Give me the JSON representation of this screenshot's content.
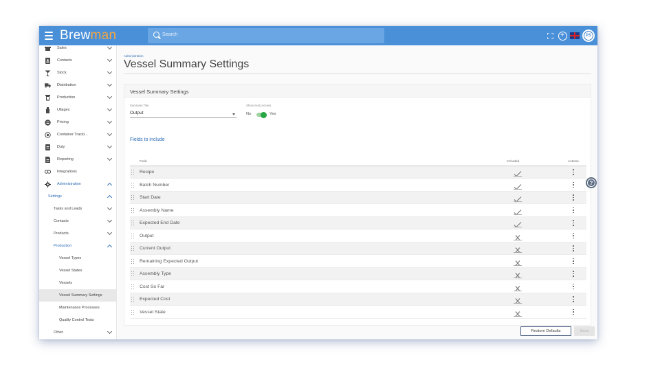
{
  "app": {
    "logo_part1": "Brew",
    "logo_part2": "man",
    "user_initials": "PS"
  },
  "search": {
    "placeholder": "Search"
  },
  "sidebar": {
    "items": [
      {
        "label": "Sales"
      },
      {
        "label": "Contacts"
      },
      {
        "label": "Stock"
      },
      {
        "label": "Distribution"
      },
      {
        "label": "Production"
      },
      {
        "label": "Ullages"
      },
      {
        "label": "Pricing"
      },
      {
        "label": "Container Tracki..."
      },
      {
        "label": "Duty"
      },
      {
        "label": "Reporting"
      },
      {
        "label": "Integrations"
      },
      {
        "label": "Administration"
      },
      {
        "label": "Settings"
      },
      {
        "label": "Tasks and Leads"
      },
      {
        "label": "Contacts"
      },
      {
        "label": "Products"
      },
      {
        "label": "Production"
      },
      {
        "label": "Vessel Types"
      },
      {
        "label": "Vessel States"
      },
      {
        "label": "Vessels"
      },
      {
        "label": "Vessel Summary Settings"
      },
      {
        "label": "Maintenance Processes"
      },
      {
        "label": "Quality Control Tests"
      },
      {
        "label": "Other"
      }
    ]
  },
  "breadcrumb": "Administration",
  "page_title": "Vessel Summary Settings",
  "card": {
    "title": "Vessel Summary Settings",
    "summary_title_label": "Summary Title",
    "summary_title_value": "Output",
    "show_next_label": "Show next process",
    "toggle_no": "No",
    "toggle_yes": "Yes",
    "section_title": "Fields to include"
  },
  "table": {
    "headers": {
      "field": "Field",
      "included": "Included",
      "actions": "Actions"
    },
    "rows": [
      {
        "name": "Recipe",
        "included": true
      },
      {
        "name": "Batch Number",
        "included": true
      },
      {
        "name": "Start Date",
        "included": true
      },
      {
        "name": "Assembly Name",
        "included": true
      },
      {
        "name": "Expected End Date",
        "included": true
      },
      {
        "name": "Output",
        "included": false
      },
      {
        "name": "Current Output",
        "included": false
      },
      {
        "name": "Remaining Expected Output",
        "included": false
      },
      {
        "name": "Assembly Type",
        "included": false
      },
      {
        "name": "Cost So Far",
        "included": false
      },
      {
        "name": "Expected Cost",
        "included": false
      },
      {
        "name": "Vessel State",
        "included": false
      }
    ]
  },
  "buttons": {
    "restore": "Restore Defaults",
    "save": "Save"
  },
  "colors": {
    "topbar": "#4a90d9",
    "accent": "#2f6db5",
    "logo_accent": "#f5a640",
    "toggle_on": "#28a745"
  }
}
